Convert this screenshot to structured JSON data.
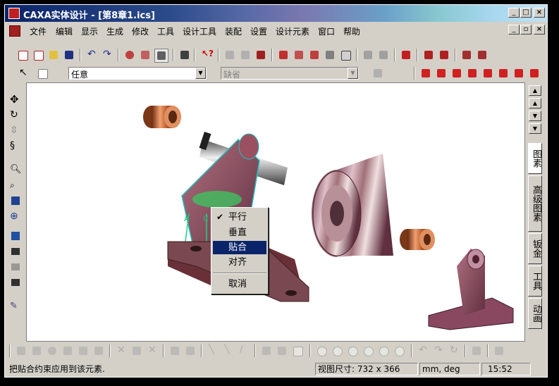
{
  "window": {
    "title": "CAXA实体设计 - [第8章1.ics]",
    "caption_buttons": [
      "minimize",
      "maximize",
      "close"
    ]
  },
  "menubar": {
    "items": [
      "文件",
      "编辑",
      "显示",
      "生成",
      "修改",
      "工具",
      "设计工具",
      "装配",
      "设置",
      "设计元素",
      "窗口",
      "帮助"
    ]
  },
  "toolbar2": {
    "combo1_value": "任意",
    "combo2_value": "缺省"
  },
  "right_panel": {
    "tabs": [
      "图素",
      "高级图素",
      "钣金",
      "工具",
      "动画"
    ]
  },
  "context_menu": {
    "items": [
      {
        "label": "平行",
        "checked": true,
        "selected": false
      },
      {
        "label": "垂直",
        "checked": false,
        "selected": false
      },
      {
        "label": "贴合",
        "checked": false,
        "selected": true
      },
      {
        "label": "对齐",
        "checked": false,
        "selected": false
      },
      {
        "label": "取消",
        "checked": false,
        "selected": false
      }
    ]
  },
  "statusbar": {
    "message": "把贴合约束应用到该元素.",
    "view_size": "视图尺寸:  732 x  366",
    "units": "mm, deg",
    "time": "15:52"
  },
  "scene_labels": {
    "label_a": "A",
    "label_c": "C"
  },
  "colors": {
    "selection": "#0a246a",
    "face": "#d4d0c8",
    "title_start": "#0a246a"
  },
  "icons": {
    "left_toolbar": [
      "move-icon",
      "rotate-icon",
      "walk-icon",
      "pan-icon",
      "zoom-icon",
      "zoom-window-icon",
      "fit-icon",
      "target-icon",
      "camera-orbit-icon",
      "camera-icon",
      "camera-pan-icon",
      "camera-fit-icon",
      "pencil-icon"
    ]
  }
}
